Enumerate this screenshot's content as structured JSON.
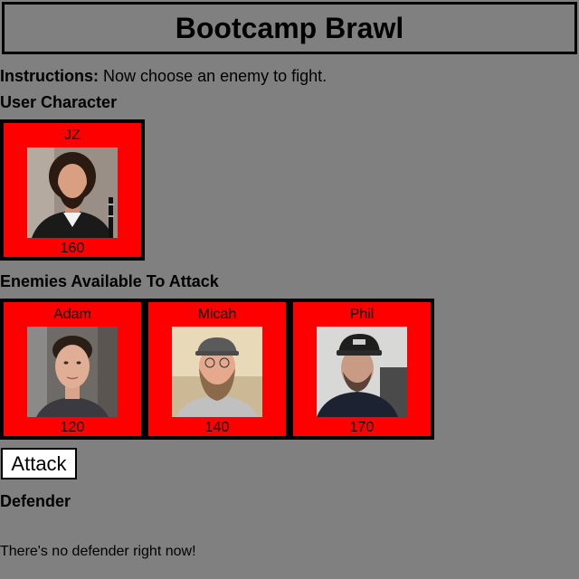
{
  "game": {
    "title": "Bootcamp Brawl"
  },
  "instructions": {
    "label": "Instructions:",
    "text": "Now choose an enemy to fight."
  },
  "user_section": {
    "heading": "User Character",
    "character": {
      "name": "JZ",
      "hp": "160"
    }
  },
  "enemies_section": {
    "heading": "Enemies Available To Attack",
    "enemies": [
      {
        "name": "Adam",
        "hp": "120"
      },
      {
        "name": "Micah",
        "hp": "140"
      },
      {
        "name": "Phil",
        "hp": "170"
      }
    ]
  },
  "attack_button": {
    "label": "Attack"
  },
  "defender_section": {
    "heading": "Defender",
    "empty_message": "There's no defender right now!"
  },
  "colors": {
    "background": "#808080",
    "card_background": "#ff0000",
    "card_border": "#000000"
  }
}
